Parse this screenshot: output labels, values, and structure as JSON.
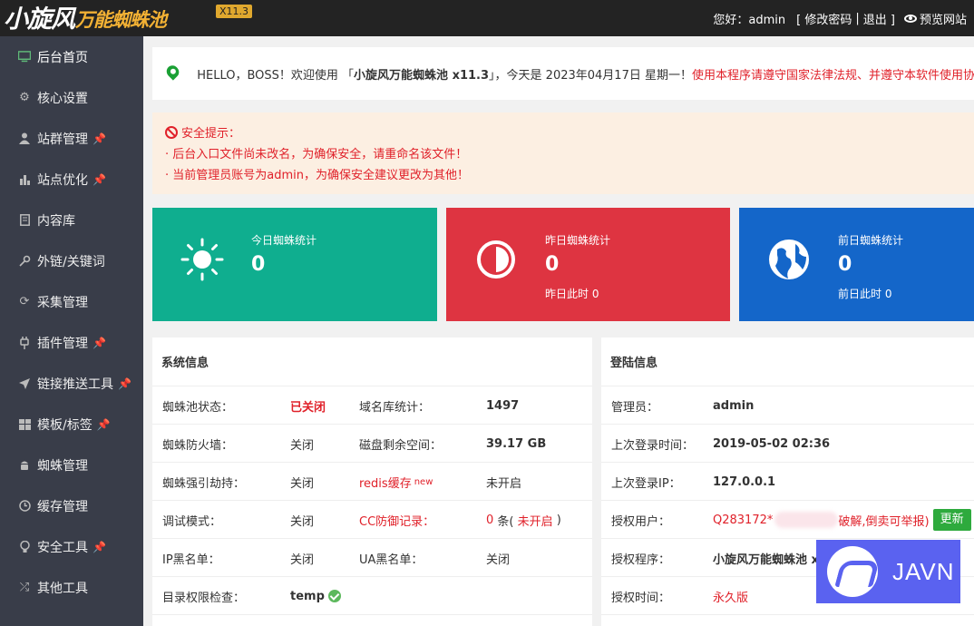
{
  "header": {
    "logo_main": "小旋风",
    "logo_sub": "万能蜘蛛池",
    "version_badge": "X11.3",
    "greeting": "您好：admin",
    "change_password": "[ 修改密码",
    "sep": "|",
    "logout": "退出 ]",
    "preview": "预览网站"
  },
  "sidebar": {
    "items": [
      {
        "label": "后台首页",
        "icon": "monitor-icon",
        "pinned": false,
        "active": true
      },
      {
        "label": "核心设置",
        "icon": "gear-icon",
        "pinned": false
      },
      {
        "label": "站群管理",
        "icon": "user-icon",
        "pinned": true
      },
      {
        "label": "站点优化",
        "icon": "bar-chart-icon",
        "pinned": true
      },
      {
        "label": "内容库",
        "icon": "document-icon",
        "pinned": false
      },
      {
        "label": "外链/关键词",
        "icon": "key-icon",
        "pinned": false
      },
      {
        "label": "采集管理",
        "icon": "refresh-icon",
        "pinned": false
      },
      {
        "label": "插件管理",
        "icon": "plug-icon",
        "pinned": true
      },
      {
        "label": "链接推送工具",
        "icon": "send-icon",
        "pinned": true
      },
      {
        "label": "模板/标签",
        "icon": "grid-icon",
        "pinned": true
      },
      {
        "label": "蜘蛛管理",
        "icon": "android-icon",
        "pinned": false
      },
      {
        "label": "缓存管理",
        "icon": "clock-icon",
        "pinned": false
      },
      {
        "label": "安全工具",
        "icon": "bulb-icon",
        "pinned": true
      },
      {
        "label": "其他工具",
        "icon": "shuffle-icon",
        "pinned": false
      }
    ]
  },
  "welcome": {
    "prefix": "HELLO，BOSS！欢迎使用 「",
    "product": "小旋风万能蜘蛛池 x11.3",
    "suffix": "」，今天是 2023年04月17日 星期一！",
    "notice": "使用本程序请遵守国家法律法规、并遵守本软件使用协议"
  },
  "alert": {
    "title": "安全提示：",
    "lines": [
      "· 后台入口文件尚未改名，为确保安全，请重命名该文件！",
      "· 当前管理员账号为admin，为确保安全建议更改为其他！"
    ]
  },
  "stats": [
    {
      "title": "今日蜘蛛统计",
      "value": "0",
      "sub": "",
      "color": "#0fae8f",
      "icon": "sun-icon"
    },
    {
      "title": "昨日蜘蛛统计",
      "value": "0",
      "sub": "昨日此时 0",
      "color": "#de3441",
      "icon": "half-circle-icon"
    },
    {
      "title": "前日蜘蛛统计",
      "value": "0",
      "sub": "前日此时 0",
      "color": "#1466c9",
      "icon": "globe-icon"
    }
  ],
  "system": {
    "title": "系统信息",
    "rows": [
      {
        "k1": "蜘蛛池状态：",
        "v1": "已关闭",
        "k2": "域名库统计：",
        "v2": "1497"
      },
      {
        "k1": "蜘蛛防火墙：",
        "v1": "关闭",
        "k2": "磁盘剩余空间：",
        "v2": "39.17 GB"
      },
      {
        "k1": "蜘蛛强引劫持：",
        "v1": "关闭",
        "k2": "redis缓存",
        "k2_sup": "new",
        "v2": "未开启"
      },
      {
        "k1": "调试模式：",
        "v1": "关闭",
        "k2": "CC防御记录：",
        "v2_a": "0",
        "v2_b": "条(",
        "v2_c": "未开启",
        "v2_d": ")"
      },
      {
        "k1": "IP黑名单：",
        "v1": "关闭",
        "k2": "UA黑名单：",
        "v2": "关闭"
      },
      {
        "k1": "目录权限检查：",
        "v1": "temp",
        "k2": "",
        "v2": ""
      }
    ]
  },
  "login": {
    "title": "登陆信息",
    "rows": [
      {
        "k": "管理员：",
        "v": "admin"
      },
      {
        "k": "上次登录时间：",
        "v": "2019-05-02 02:36"
      },
      {
        "k": "上次登录IP：",
        "v": "127.0.0.1"
      },
      {
        "k": "授权用户：",
        "v": "Q283172*",
        "v_tail": "破解,倒卖可举报)",
        "button": "更新"
      },
      {
        "k": "授权程序：",
        "v": "小旋风万能蜘蛛池 x"
      },
      {
        "k": "授权时间：",
        "v": "永久版"
      }
    ]
  },
  "watermark": {
    "text": "JAVN"
  }
}
